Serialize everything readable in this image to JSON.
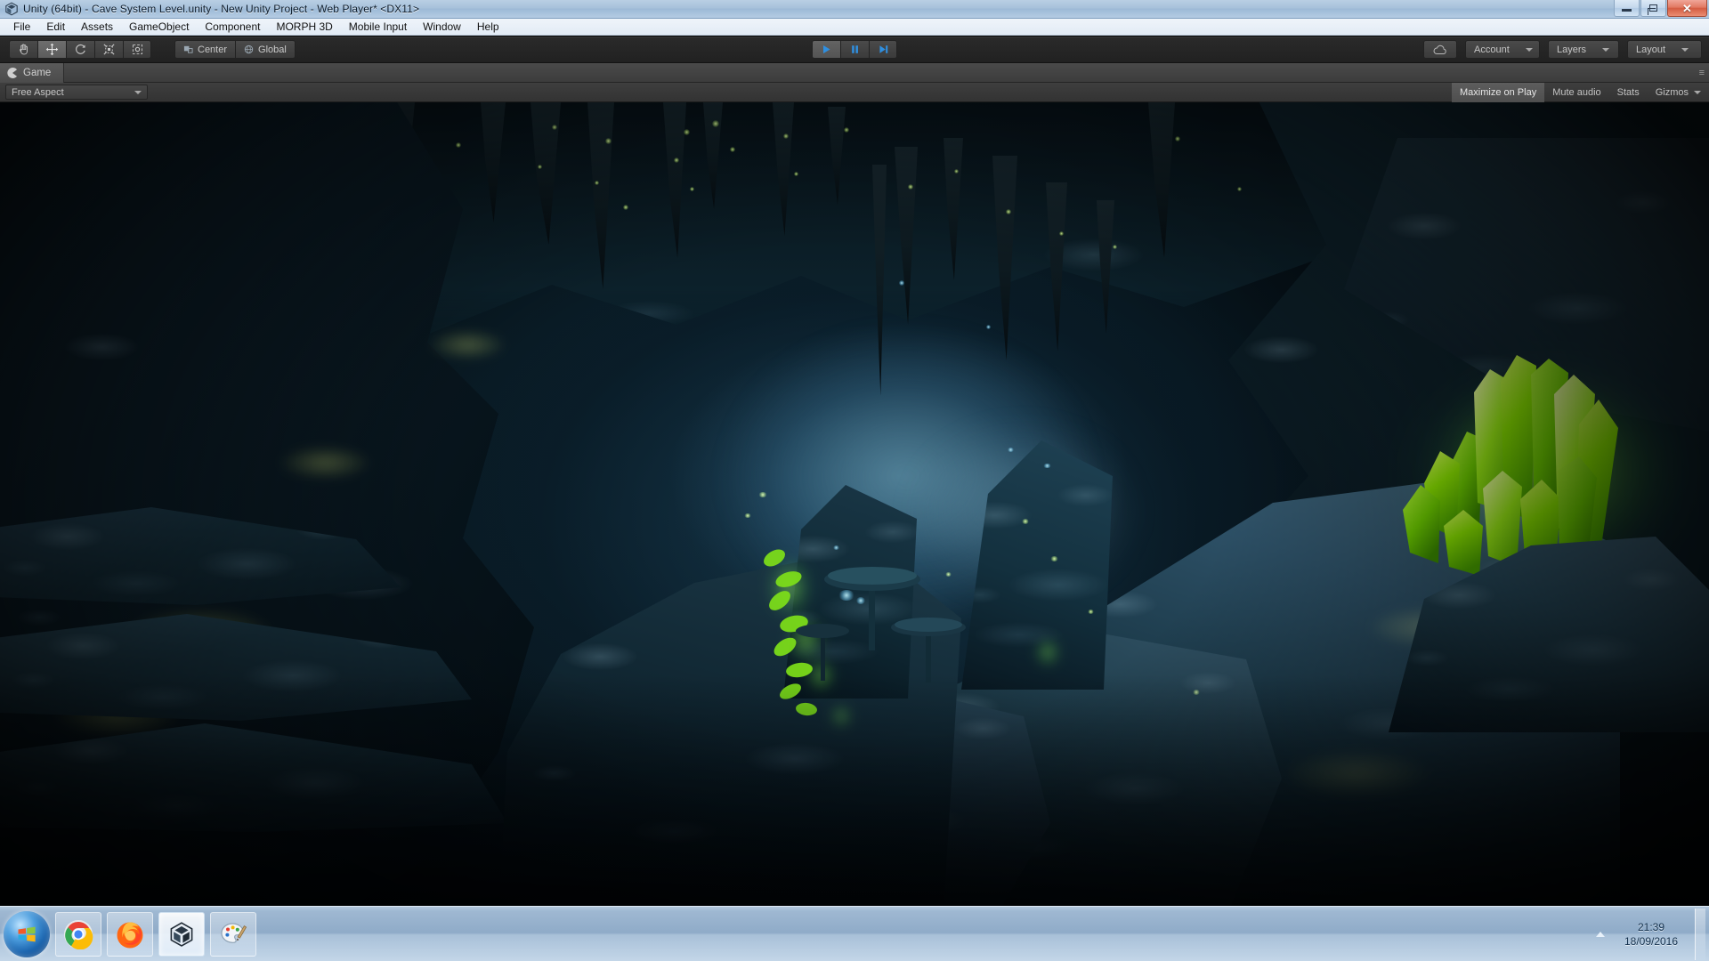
{
  "window": {
    "title": "Unity (64bit) - Cave System Level.unity - New Unity Project - Web Player* <DX11>",
    "app_icon": "unity-icon",
    "controls": {
      "minimize": "minimize-icon",
      "restore": "restore-icon",
      "close": "close-icon"
    }
  },
  "menubar": {
    "items": [
      {
        "label": "File"
      },
      {
        "label": "Edit"
      },
      {
        "label": "Assets"
      },
      {
        "label": "GameObject"
      },
      {
        "label": "Component"
      },
      {
        "label": "MORPH 3D"
      },
      {
        "label": "Mobile Input"
      },
      {
        "label": "Window"
      },
      {
        "label": "Help"
      }
    ]
  },
  "toolbar": {
    "transform_tools": [
      {
        "name": "hand-tool",
        "icon": "hand-icon",
        "active": false
      },
      {
        "name": "move-tool",
        "icon": "move-arrows-icon",
        "active": true
      },
      {
        "name": "rotate-tool",
        "icon": "rotate-icon",
        "active": false
      },
      {
        "name": "scale-tool",
        "icon": "scale-icon",
        "active": false
      },
      {
        "name": "rect-tool",
        "icon": "rect-transform-icon",
        "active": false
      }
    ],
    "pivot_label": "Center",
    "pivot_icon": "pivot-center-icon",
    "rotation_label": "Global",
    "rotation_icon": "globe-icon",
    "play_controls": [
      {
        "name": "play-button",
        "icon": "play-icon",
        "active": true
      },
      {
        "name": "pause-button",
        "icon": "pause-icon",
        "active": false
      },
      {
        "name": "step-button",
        "icon": "step-icon",
        "active": false
      }
    ],
    "cloud_icon": "cloud-icon",
    "account_label": "Account",
    "layers_label": "Layers",
    "layout_label": "Layout"
  },
  "gameview": {
    "tab_label": "Game",
    "tab_icon": "game-view-icon",
    "tab_menu_icon": "tab-context-menu-icon",
    "aspect_label": "Free Aspect",
    "toggles": [
      {
        "label": "Maximize on Play",
        "on": true
      },
      {
        "label": "Mute audio",
        "on": false
      },
      {
        "label": "Stats",
        "on": false
      },
      {
        "label": "Gizmos",
        "on": false
      }
    ],
    "gizmos_caret_icon": "chevron-down-icon",
    "scene": {
      "name": "Cave System Level",
      "description": "Dark underwater cave interior with stalactites, glowing green crystal cluster at right, bioluminescent plants and mushrooms at center, layered blue-grey rock ledges, hazy teal light shaft through a far opening.",
      "palette": {
        "deep_shadow": "#010407",
        "rock_dark": "#0b1a22",
        "rock_mid": "#1d3a49",
        "rock_light": "#4b7286",
        "water_teal": "#2d6a8a",
        "haze_light": "#86b4c8",
        "crystal_green": "#7fe800",
        "crystal_core": "#c8ff4a",
        "moss_yellow": "#a8b04e",
        "spark_blue": "#9fdcf5"
      }
    }
  },
  "taskbar": {
    "start_label": "start-orb",
    "apps": [
      {
        "name": "chrome",
        "icon": "chrome-icon",
        "state": "pinned"
      },
      {
        "name": "firefox",
        "icon": "firefox-icon",
        "state": "pinned"
      },
      {
        "name": "unity",
        "icon": "unity-icon",
        "state": "active"
      },
      {
        "name": "paint",
        "icon": "paint-icon",
        "state": "pinned"
      }
    ],
    "tray": {
      "show_hidden_icon": "triangle-up-icon",
      "time": "21:39",
      "date": "18/09/2016",
      "show_desktop": "show-desktop-button"
    }
  }
}
